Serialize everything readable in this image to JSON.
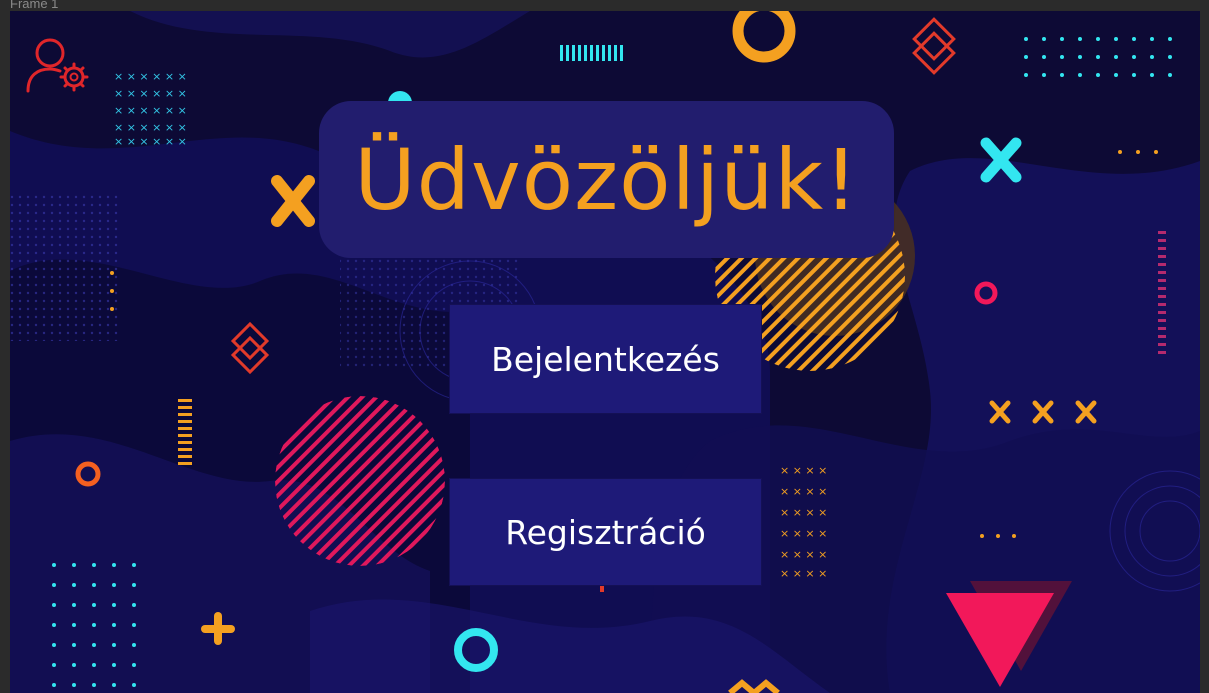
{
  "window": {
    "frame_label": "Frame 1"
  },
  "hero": {
    "title": "Üdvözöljük!"
  },
  "actions": {
    "login_label": "Bejelentkezés",
    "register_label": "Regisztráció"
  },
  "toolbar": {
    "user_settings_icon": "user-settings-icon"
  },
  "colors": {
    "background": "#0d0a35",
    "panel": "#221d6e",
    "button": "#1e1a78",
    "accent_orange": "#f4a020",
    "accent_cyan": "#33e6f0",
    "accent_pink": "#f2185a",
    "icon_red": "#e0262a"
  }
}
